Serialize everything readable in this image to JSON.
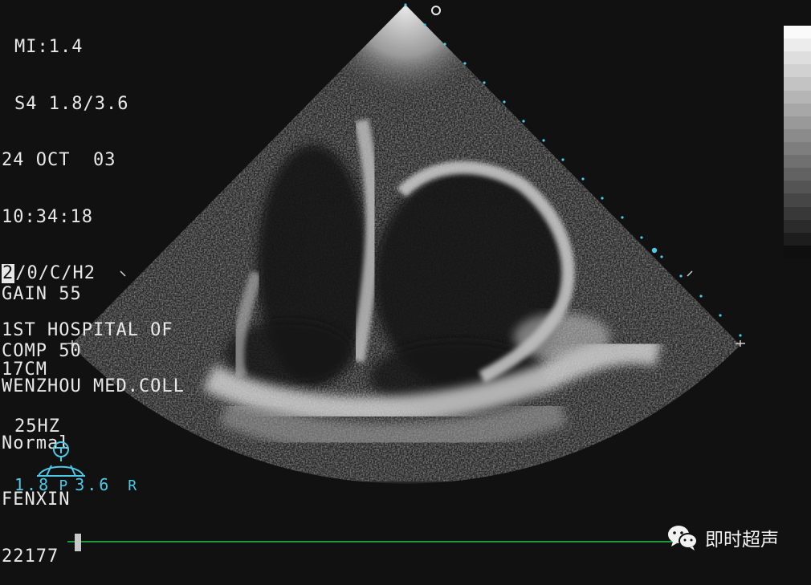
{
  "header_info": {
    "mi": "MI:1.4",
    "probe_setting": "S4 1.8/3.6",
    "date": "24 OCT  03",
    "time": "10:34:18",
    "mode_boxed": "2",
    "mode_rest": "/0/C/H2",
    "institution_line1": "1ST HOSPITAL OF",
    "institution_line2": "WENZHOU MED.COLL",
    "preset": "Normal",
    "patient_name": "FENXIN",
    "patient_id": "22177"
  },
  "acquisition": {
    "gain": "GAIN 55",
    "comp": "COMP 50",
    "depth": "17CM",
    "frame_rate": "25HZ"
  },
  "probe_indicator": {
    "left_label": "P",
    "right_label": "R",
    "frequencies": "1.8  3.6"
  },
  "orientation_marker": "o",
  "watermark": {
    "icon": "wechat-icon",
    "text": "即时超声"
  },
  "colors": {
    "overlay_text": "#e8e8e8",
    "probe_cyan": "#4ec9e8",
    "timeline_green": "#1e9a3a",
    "background": "#111111"
  }
}
